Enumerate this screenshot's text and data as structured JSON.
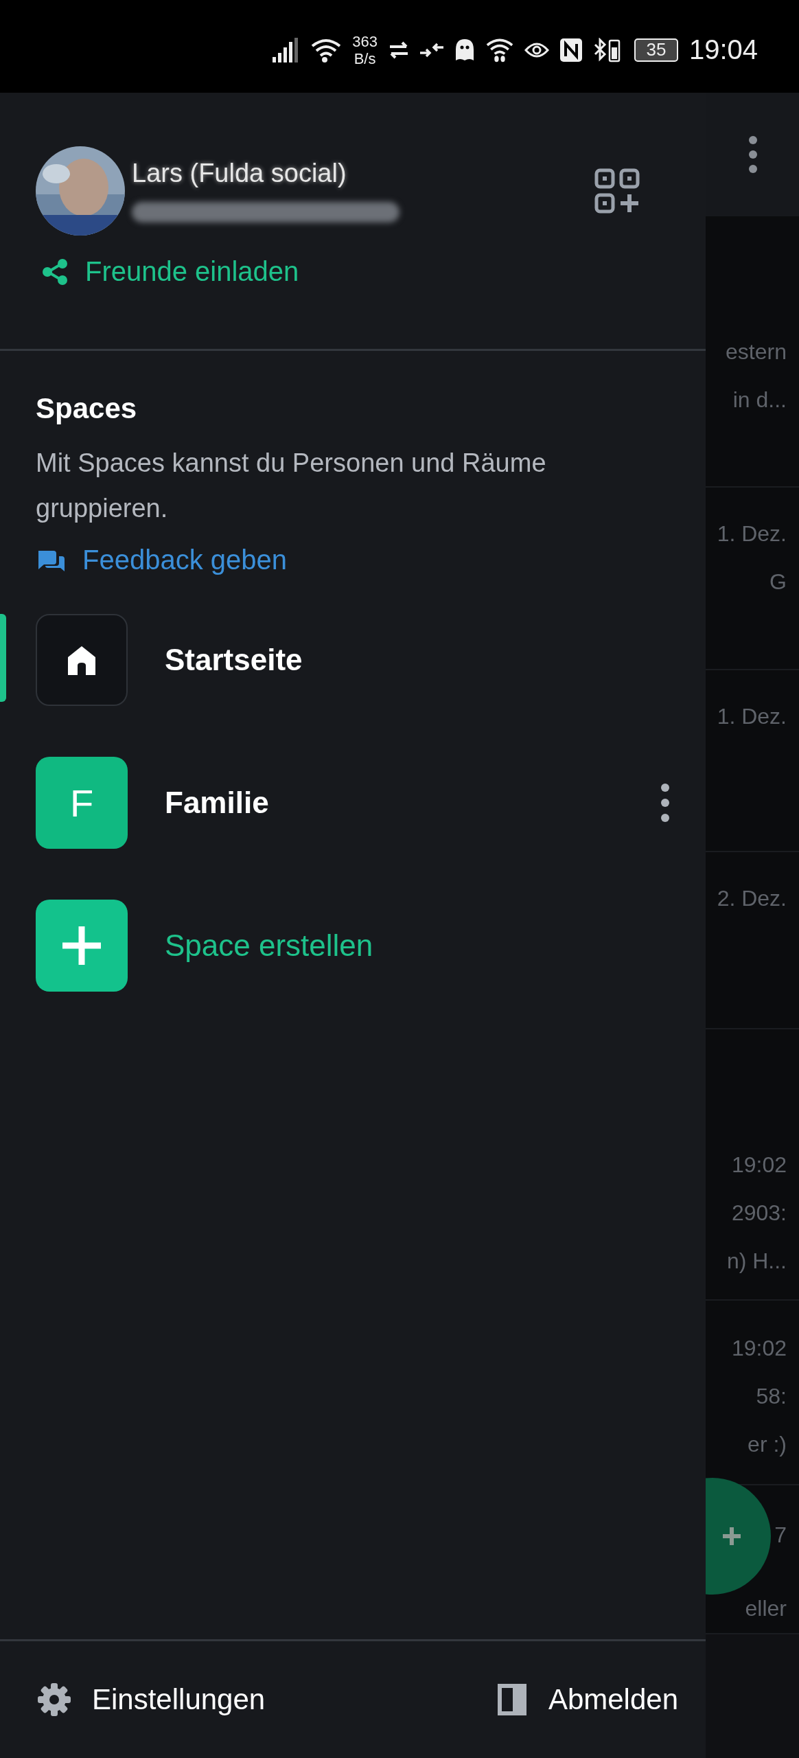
{
  "status_bar": {
    "net_speed": "363",
    "net_unit": "B/s",
    "battery": "35",
    "time": "19:04"
  },
  "account": {
    "name": "Lars (Fulda social)",
    "invite": "Freunde einladen"
  },
  "spaces": {
    "title": "Spaces",
    "description": "Mit Spaces kannst du Personen und Räume gruppieren.",
    "feedback": "Feedback geben",
    "items": [
      {
        "kind": "home",
        "label": "Startseite",
        "selected": true
      },
      {
        "kind": "letter",
        "letter": "F",
        "label": "Familie",
        "selected": false
      },
      {
        "kind": "add",
        "label": "Space erstellen",
        "selected": false
      }
    ]
  },
  "footer": {
    "settings": "Einstellungen",
    "logout": "Abmelden"
  },
  "background_list": {
    "rows": [
      {
        "lines": [
          "estern",
          "in d..."
        ]
      },
      {
        "lines": [
          "1. Dez.",
          "G"
        ]
      },
      {
        "lines": [
          "1. Dez."
        ]
      },
      {
        "lines": [
          "2. Dez."
        ]
      },
      {
        "lines": [
          "19:02",
          "2903:",
          "n) H..."
        ]
      },
      {
        "lines": [
          "19:02",
          "58:",
          "er :)"
        ]
      },
      {
        "lines": [
          "7",
          "eller"
        ]
      }
    ]
  }
}
